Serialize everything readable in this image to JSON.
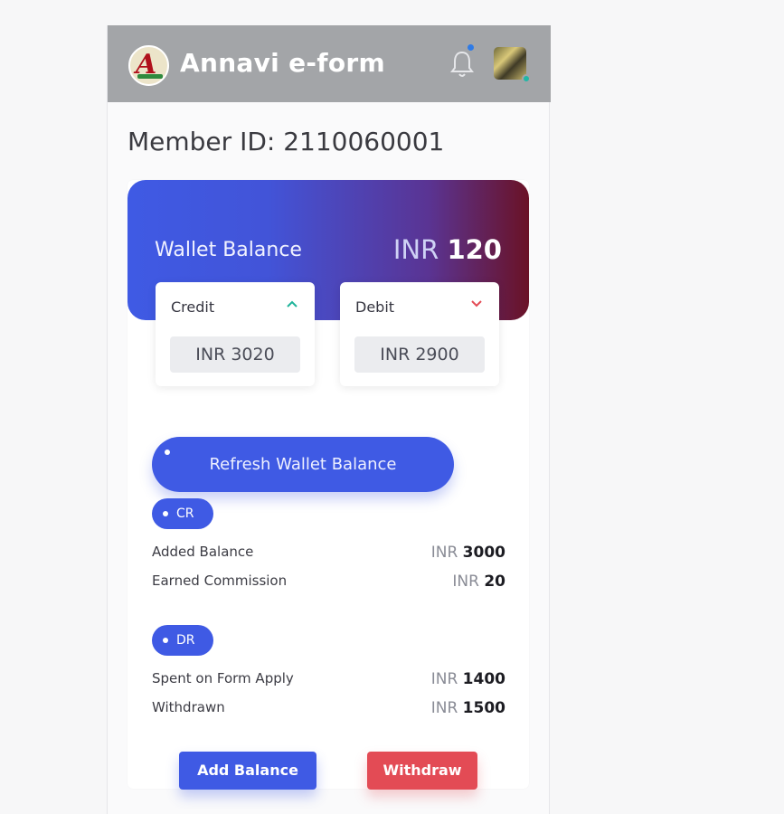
{
  "app": {
    "title": "Annavi e-form"
  },
  "header": {
    "notification_dot_color": "#2f7be6",
    "status_color": "#21b7a6"
  },
  "member": {
    "label": "Member ID: 2110060001"
  },
  "wallet": {
    "label": "Wallet Balance",
    "currency": "INR",
    "amount": "120",
    "credit": {
      "title": "Credit",
      "amount": "INR 3020",
      "icon": "chevron-up-icon",
      "color": "#1eb39a"
    },
    "debit": {
      "title": "Debit",
      "amount": "INR 2900",
      "icon": "chevron-down-icon",
      "color": "#e34b55"
    }
  },
  "refresh_label": "Refresh Wallet Balance",
  "cr": {
    "badge": "CR",
    "rows": [
      {
        "label": "Added Balance",
        "currency": "INR",
        "amount": "3000"
      },
      {
        "label": "Earned Commission",
        "currency": "INR",
        "amount": "20"
      }
    ]
  },
  "dr": {
    "badge": "DR",
    "rows": [
      {
        "label": "Spent on Form Apply",
        "currency": "INR",
        "amount": "1400"
      },
      {
        "label": "Withdrawn",
        "currency": "INR",
        "amount": "1500"
      }
    ]
  },
  "actions": {
    "add_balance": "Add Balance",
    "withdraw": "Withdraw"
  },
  "colors": {
    "primary": "#3f5ae4",
    "danger": "#e34b55",
    "header_bg": "#a3a5a8"
  }
}
